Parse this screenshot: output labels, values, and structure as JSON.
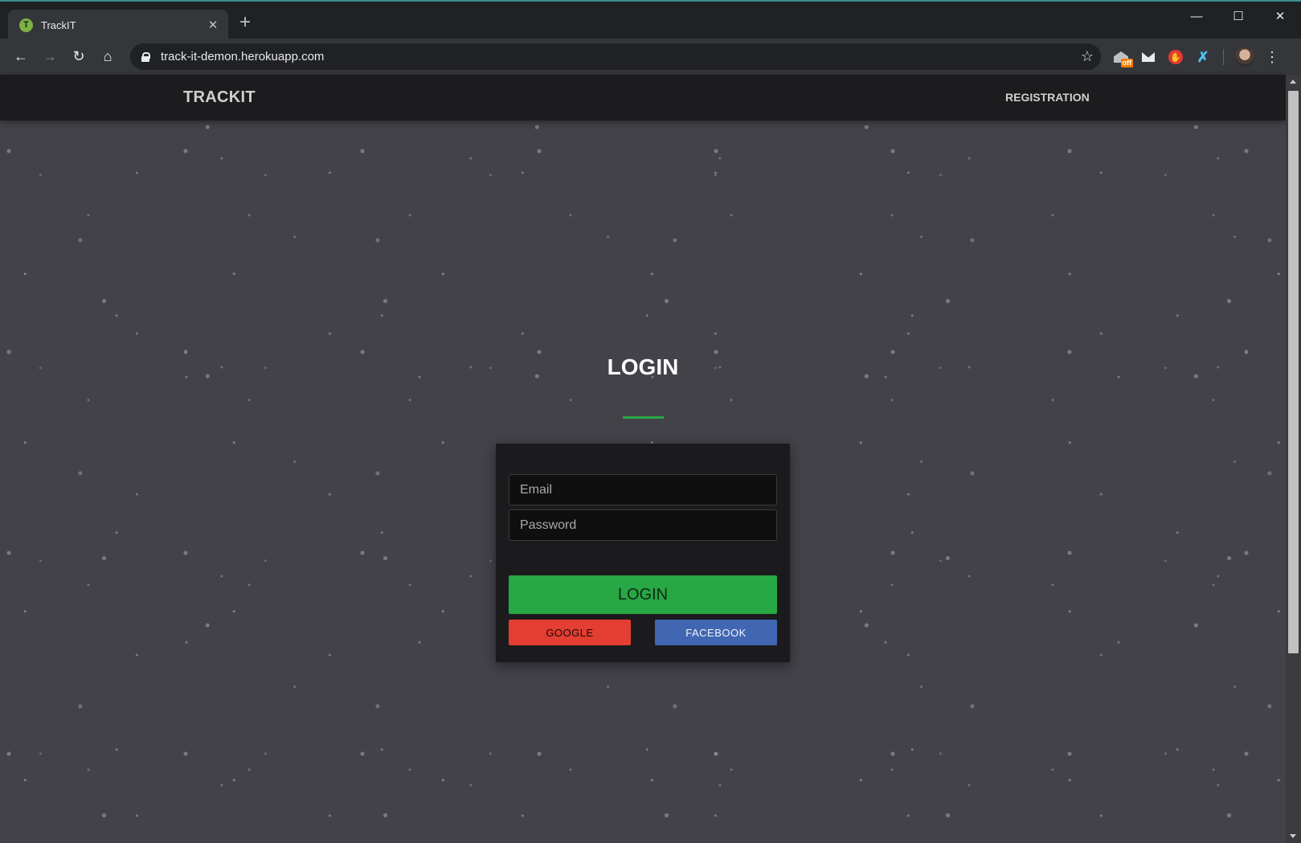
{
  "browser": {
    "tab_title": "TrackIT",
    "favicon_letter": "T",
    "url": "track-it-demon.herokuapp.com",
    "extension_badge": "off"
  },
  "site": {
    "brand": "TRACKIT",
    "nav_link": "REGISTRATION"
  },
  "login": {
    "title": "LOGIN",
    "email_placeholder": "Email",
    "password_placeholder": "Password",
    "submit_label": "LOGIN",
    "google_label": "GOOGLE",
    "facebook_label": "FACEBOOK"
  },
  "colors": {
    "accent": "#28a745",
    "google": "#e43d32",
    "facebook": "#4267b2",
    "page_background": "#434249",
    "navbar": "#1c1c1f"
  }
}
